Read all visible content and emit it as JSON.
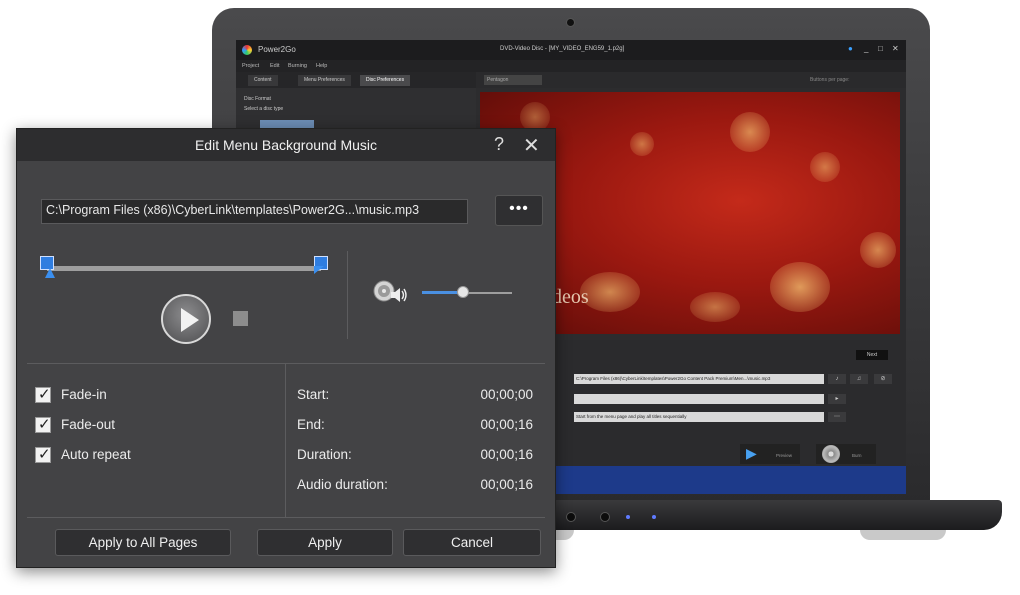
{
  "app": {
    "name": "Power2Go",
    "document": "DVD-Video Disc - [MY_VIDEO_ENG59_1.p2g]",
    "menus": [
      "Project",
      "Edit",
      "Burning",
      "Help"
    ],
    "tabs": [
      "Content",
      "Menu Preferences",
      "Disc Preferences"
    ],
    "left_pane": {
      "title": "Disc Format",
      "subtitle": "Select a disc type"
    },
    "toolbar_field": "Pentagon",
    "buttons_per_page": "Buttons per page:",
    "preview_text": "deos",
    "next_label": "Next",
    "music_path": "C:\\Program Files (x86)\\CyberLink\\templates\\Power2Go Content Pack Premium\\Men...\\music.mp3",
    "playback_mode": "Start from the menu page and play all titles sequentially",
    "preview_label": "Preview",
    "burn_label": "Burn"
  },
  "dialog": {
    "title": "Edit Menu Background Music",
    "help_glyph": "?",
    "close_glyph": "✕",
    "file_path": "C:\\Program Files (x86)\\CyberLink\\templates\\Power2G...\\music.mp3",
    "browse_label": "•••",
    "volume_level": 0.45,
    "range_start": 0.0,
    "range_end": 1.0,
    "options": [
      {
        "label": "Fade-in",
        "checked": true
      },
      {
        "label": "Fade-out",
        "checked": true
      },
      {
        "label": "Auto repeat",
        "checked": true
      }
    ],
    "info": [
      {
        "label": "Start:",
        "value": "00;00;00"
      },
      {
        "label": "End:",
        "value": "00;00;16"
      },
      {
        "label": "Duration:",
        "value": "00;00;16"
      },
      {
        "label": "Audio duration:",
        "value": "00;00;16"
      }
    ],
    "buttons": {
      "apply_all": "Apply to All Pages",
      "apply": "Apply",
      "cancel": "Cancel"
    }
  },
  "colors": {
    "accent": "#2f7de0",
    "dialog_bg": "#434345",
    "titlebar_bg": "#2d2d2f",
    "preview_red": "#b02014"
  }
}
